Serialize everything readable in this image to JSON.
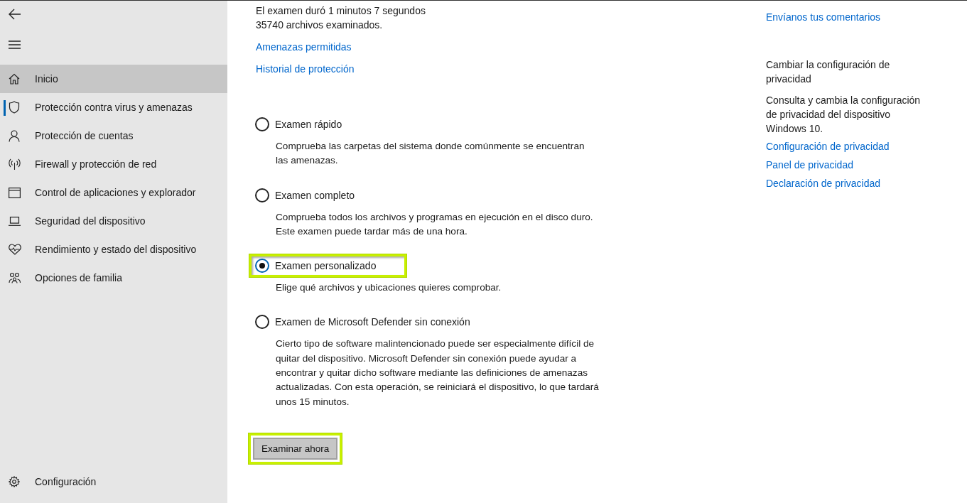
{
  "sidebar": {
    "items": [
      {
        "label": "Inicio",
        "selected": true,
        "current": false
      },
      {
        "label": "Protección contra virus y amenazas",
        "selected": false,
        "current": true
      },
      {
        "label": "Protección de cuentas",
        "selected": false,
        "current": false
      },
      {
        "label": "Firewall y protección de red",
        "selected": false,
        "current": false
      },
      {
        "label": "Control de aplicaciones y explorador",
        "selected": false,
        "current": false
      },
      {
        "label": "Seguridad del dispositivo",
        "selected": false,
        "current": false
      },
      {
        "label": "Rendimiento y estado del dispositivo",
        "selected": false,
        "current": false
      },
      {
        "label": "Opciones de familia",
        "selected": false,
        "current": false
      }
    ],
    "settings": {
      "label": "Configuración"
    }
  },
  "scan_info": [
    "El examen duró 1 minutos 7 segundos",
    "35740 archivos examinados."
  ],
  "links": [
    "Amenazas permitidas",
    "Historial de protección"
  ],
  "scan_options": [
    {
      "label": "Examen rápido",
      "description": "Comprueba las carpetas del sistema donde comúnmente se encuentran las amenazas.",
      "selected": false,
      "highlighted": false
    },
    {
      "label": "Examen completo",
      "description": "Comprueba todos los archivos y programas en ejecución en el disco duro. Este examen puede tardar más de una hora.",
      "selected": false,
      "highlighted": false
    },
    {
      "label": "Examen personalizado",
      "description": "Elige qué archivos y ubicaciones quieres comprobar.",
      "selected": true,
      "highlighted": true
    },
    {
      "label": "Examen de Microsoft Defender sin conexión",
      "description": "Cierto tipo de software malintencionado puede ser especialmente difícil de quitar del dispositivo. Microsoft Defender sin conexión puede ayudar a encontrar y quitar dicho software mediante las definiciones de amenazas actualizadas. Con esta operación, se reiniciará el dispositivo, lo que tardará unos 15 minutos.",
      "selected": false,
      "highlighted": false
    }
  ],
  "scan_button": {
    "label": "Examinar ahora",
    "highlighted": true
  },
  "right_panel": {
    "feedback_link": "Envíanos tus comentarios",
    "privacy": {
      "heading": "Cambiar la configuración de privacidad",
      "text": "Consulta y cambia la configuración de privacidad del dispositivo Windows 10.",
      "links": [
        "Configuración de privacidad",
        "Panel de privacidad",
        "Declaración de privacidad"
      ]
    }
  }
}
